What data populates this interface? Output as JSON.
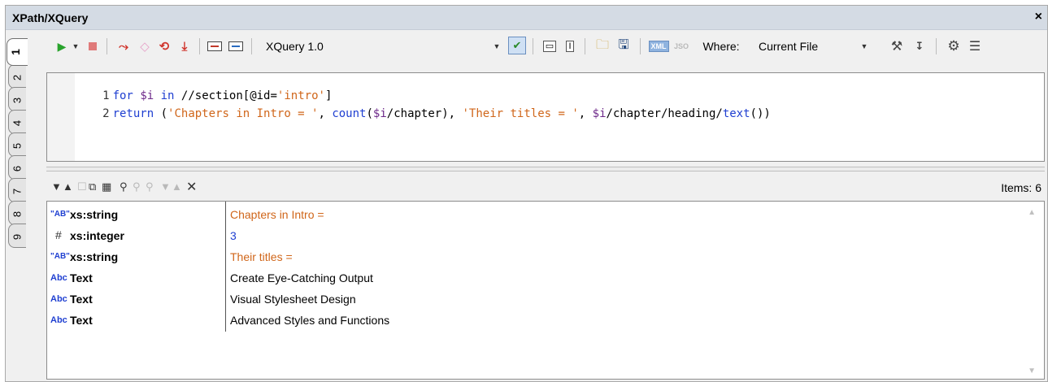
{
  "window": {
    "title": "XPath/XQuery",
    "close_glyph": "×"
  },
  "tabs": [
    "1",
    "2",
    "3",
    "4",
    "5",
    "6",
    "7",
    "8",
    "9"
  ],
  "toolbar": {
    "version": "XQuery 1.0",
    "xml_label": "XML",
    "json_label": "JSO",
    "where_label": "Where:",
    "where_value": "Current File"
  },
  "editor": {
    "lines": [
      {
        "num": "1",
        "text": "for $i in //section[@id='intro']"
      },
      {
        "num": "2",
        "text": "return ('Chapters in Intro = ', count($i/chapter), 'Their titles = ', $i/chapter/heading/text())"
      }
    ]
  },
  "results": {
    "items_label": "Items: 6",
    "rows": [
      {
        "icon": "\"AB\"",
        "type": "xs:string",
        "value": "Chapters in Intro ="
      },
      {
        "icon": "#",
        "type": "xs:integer",
        "value": "3"
      },
      {
        "icon": "\"AB\"",
        "type": "xs:string",
        "value": "Their titles ="
      },
      {
        "icon": "Abc",
        "type": "Text",
        "value": "Create Eye-Catching Output"
      },
      {
        "icon": "Abc",
        "type": "Text",
        "value": "Visual Stylesheet Design"
      },
      {
        "icon": "Abc",
        "type": "Text",
        "value": "Advanced Styles and Functions"
      }
    ]
  },
  "colors": {
    "string_value": "#d0661a",
    "integer_value": "#1f3fd1",
    "keyword": "#1f3fd1"
  }
}
